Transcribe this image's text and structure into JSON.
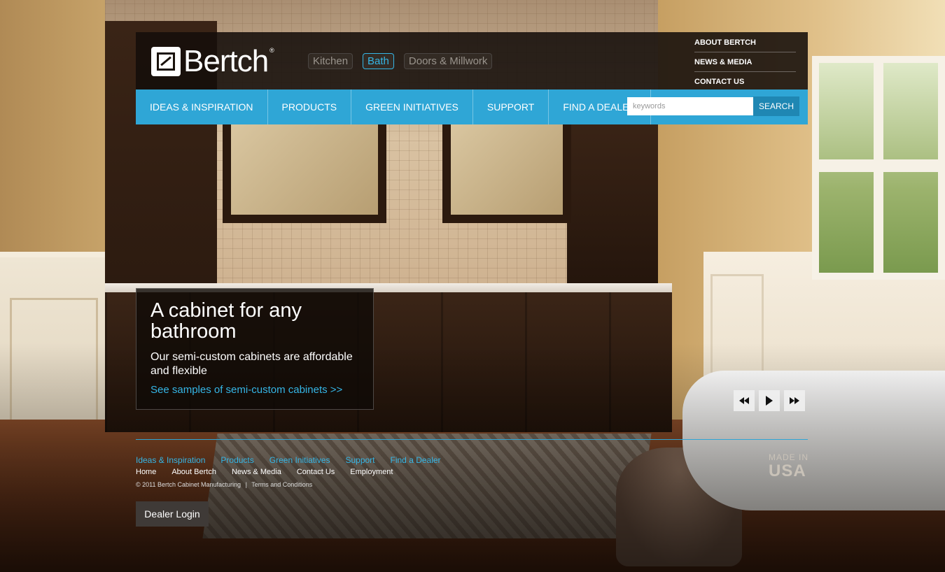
{
  "brand": {
    "name": "Bertch",
    "reg": "®"
  },
  "category_tabs": [
    {
      "label": "Kitchen",
      "active": false
    },
    {
      "label": "Bath",
      "active": true
    },
    {
      "label": "Doors & Millwork",
      "active": false
    }
  ],
  "util_links": [
    "ABOUT BERTCH",
    "NEWS & MEDIA",
    "CONTACT US"
  ],
  "nav": [
    "IDEAS & INSPIRATION",
    "PRODUCTS",
    "GREEN INITIATIVES",
    "SUPPORT",
    "FIND A DEALER"
  ],
  "search": {
    "placeholder": "keywords",
    "button": "SEARCH"
  },
  "promo": {
    "title": "A cabinet for any bathroom",
    "text": "Our semi-custom cabinets are affordable and flexible",
    "link": "See samples of semi-custom cabinets >>"
  },
  "slideshow_controls": [
    "rewind-icon",
    "play-icon",
    "fast-forward-icon"
  ],
  "footer": {
    "primary_links": [
      "Ideas & Inspiration",
      "Products",
      "Green Initiatives",
      "Support",
      "Find a Dealer"
    ],
    "secondary_links": [
      "Home",
      "About Bertch",
      "News & Media",
      "Contact Us",
      "Employment"
    ],
    "copyright": "© 2011 Bertch Cabinet Manufacturing",
    "separator": "|",
    "terms": "Terms and Conditions",
    "made_in_small": "MADE IN",
    "made_in_big": "USA",
    "dealer_login": "Dealer Login"
  },
  "colors": {
    "accent": "#2fa6d6",
    "link": "#35b6e6",
    "header_bg": "#140e0a"
  }
}
